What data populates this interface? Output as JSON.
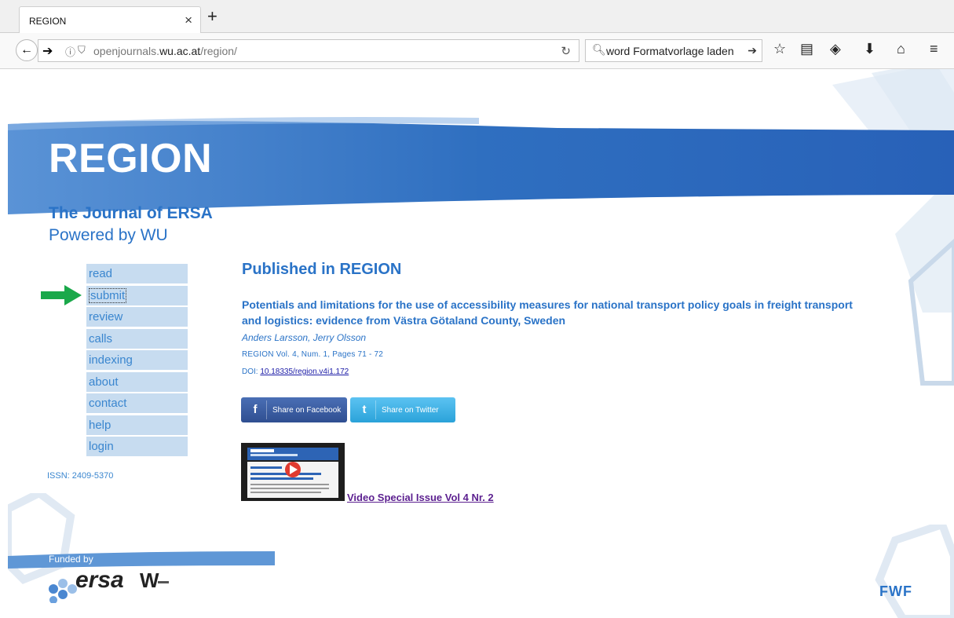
{
  "browser": {
    "tab_title": "REGION",
    "tab_close": "×",
    "new_tab": "+",
    "url_prefix": "openjournals.",
    "url_domain": "wu.ac.at",
    "url_path": "/region/",
    "search_value": "word Formatvorlage laden"
  },
  "site": {
    "title": "REGION",
    "subtitle": "The Journal of ERSA",
    "powered_by": "Powered by WU"
  },
  "menu": {
    "items": [
      "read",
      "submit",
      "review",
      "calls",
      "indexing",
      "about",
      "contact",
      "help",
      "login"
    ]
  },
  "issn": "ISSN: 2409-5370",
  "content": {
    "heading": "Published in REGION",
    "article_title": "Potentials and limitations for the use of accessibility measures for national transport policy goals in freight transport and logistics: evidence from Västra Götaland County, Sweden",
    "authors": "Anders Larsson, Jerry Olsson",
    "issue": "REGION Vol. 4, Num. 1, Pages 71 - 72",
    "doi_label": "DOI: ",
    "doi_link": "10.18335/region.v4i1.172",
    "share_facebook": "Share on Facebook",
    "share_twitter": "Share on Twitter",
    "video_link": "Video Special Issue Vol 4 Nr. 2"
  },
  "footer": {
    "funded_by": "Funded by",
    "ersa": "ersa",
    "wu": "W",
    "fwf": "FWF"
  },
  "colors": {
    "brand_blue": "#2a73c7",
    "menu_bg": "#c7dcf0",
    "arrow": "#1aa84a"
  }
}
